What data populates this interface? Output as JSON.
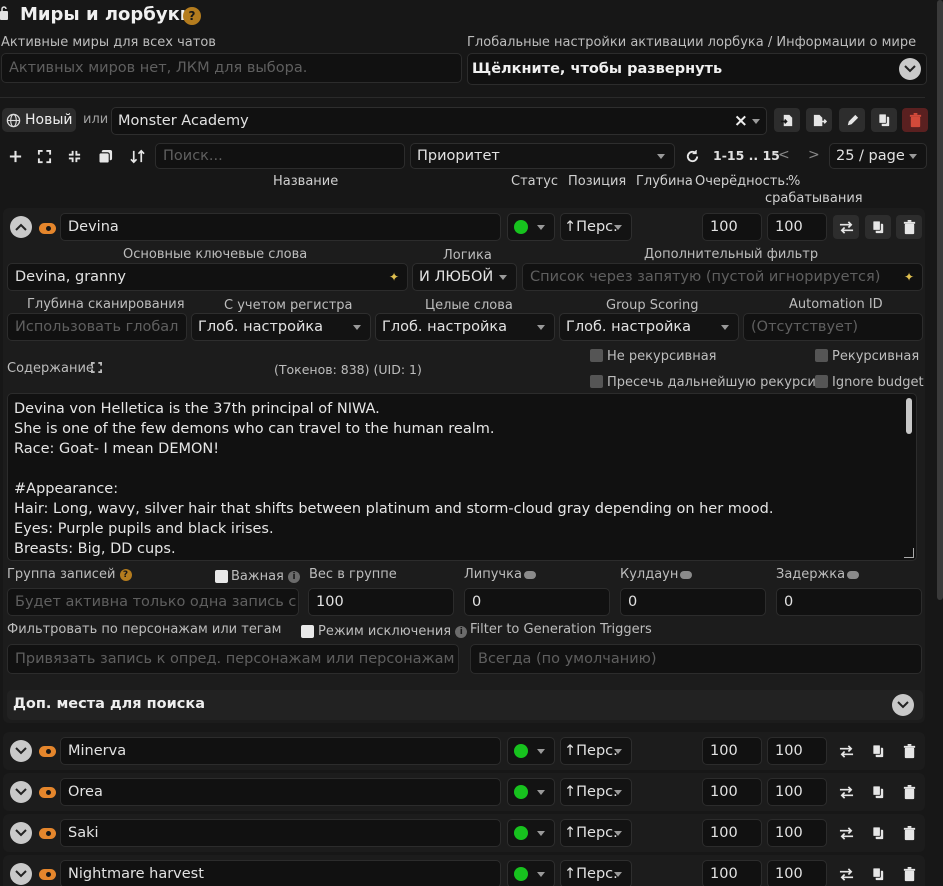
{
  "header": {
    "title": "Миры и лорбуки",
    "help": "?"
  },
  "active_worlds": {
    "label": "Активные миры для всех чатов",
    "placeholder": "Активных миров нет, ЛКМ для выбора."
  },
  "global_settings": {
    "label": "Глобальные настройки активации лорбука / Информации о мире",
    "button": "Щёлкните, чтобы развернуть"
  },
  "book_bar": {
    "new_label": "Новый",
    "or_label": "или",
    "selected_book": "Monster Academy",
    "clear": "×"
  },
  "toolbar": {
    "search_placeholder": "Поиск...",
    "sort_value": "Приоритет",
    "range": "1-15 .. 15",
    "prev": "<",
    "next": ">",
    "page_size": "25 / page"
  },
  "columns": {
    "name": "Название",
    "status": "Статус",
    "position": "Позиция",
    "depth": "Глубина",
    "order": "Очерёдность:",
    "trigger1": "%",
    "trigger2": "срабатывания"
  },
  "entry_open": {
    "name": "Devina",
    "position": "↑Перс.",
    "order": "100",
    "trigger": "100",
    "labels": {
      "primary_keys": "Основные ключевые слова",
      "logic": "Логика",
      "secondary_filter": "Дополнительный фильтр",
      "scan_depth": "Глубина сканирования",
      "case_sensitive": "С учетом регистра",
      "whole_words": "Целые слова",
      "group_scoring": "Group Scoring",
      "automation_id": "Automation ID",
      "content": "Содержание",
      "tokens": "(Токенов:  838)  (UID: 1)",
      "non_recursive": "Не рекурсивная",
      "recursive": "Рекурсивная",
      "prevent_recursion": "Пресечь дальнейшую рекурсию",
      "ignore_budget": "Ignore budget",
      "group": "Группа записей",
      "important": "Важная",
      "group_weight": "Вес в группе",
      "sticky": "Липучка",
      "cooldown": "Кулдаун",
      "delay": "Задержка",
      "filter_chars": "Фильтровать по персонажам или тегам",
      "exclude_mode": "Режим исключения",
      "filter_triggers": "Filter to Generation Triggers",
      "extra_search": "Доп. места для поиска"
    },
    "primary_keys_value": "Devina, granny",
    "logic_value": "И ЛЮБОЙ",
    "secondary_placeholder": "Список через запятую (пустой игнорируется)",
    "scan_depth_placeholder": "Использовать глобал",
    "case_sensitive_value": "Глоб. настройка",
    "whole_words_value": "Глоб. настройка",
    "group_scoring_value": "Глоб. настройка",
    "automation_placeholder": "(Отсутствует)",
    "content_lines": [
      "Devina von Helletica is the 37th principal of NIWA.",
      "She is one of the few demons who can travel to the human realm.",
      "Race: Goat- I mean DEMON!",
      "",
      "#Appearance:",
      "Hair: Long, wavy, silver hair that shifts between platinum and storm-cloud gray depending on her mood.",
      "Eyes: Purple pupils and black irises.",
      "Breasts: Big, DD cups."
    ],
    "group_placeholder": "Будет активна только одна запись с о,",
    "group_weight_value": "100",
    "sticky_value": "0",
    "cooldown_value": "0",
    "delay_value": "0",
    "filter_chars_placeholder": "Привязать запись к опред. персонажам или персонажам с",
    "filter_triggers_placeholder": "Всегда (по умолчанию)"
  },
  "entries": [
    {
      "name": "Minerva",
      "position": "↑Перс.",
      "order": "100",
      "trigger": "100"
    },
    {
      "name": "Orea",
      "position": "↑Перс.",
      "order": "100",
      "trigger": "100"
    },
    {
      "name": "Saki",
      "position": "↑Перс.",
      "order": "100",
      "trigger": "100"
    },
    {
      "name": "Nightmare harvest",
      "position": "↑Перс.",
      "order": "100",
      "trigger": "100"
    }
  ],
  "colors": {
    "accent_orange": "#e5862c",
    "status_green": "#17c21e",
    "delete_red": "#c0392b"
  }
}
